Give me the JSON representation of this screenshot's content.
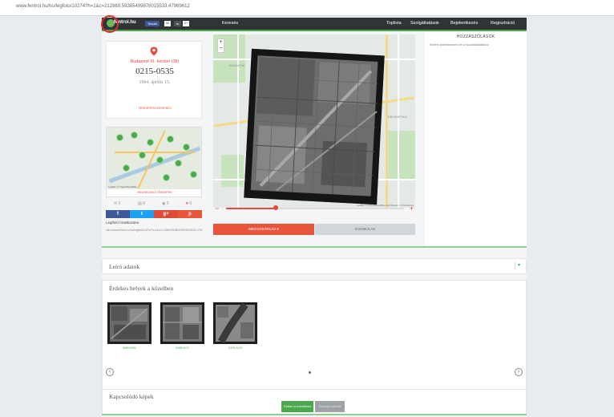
{
  "browser": {
    "url": "www.fentrol.hu/hu/fegfoto/10274?h=1&c=212869.59385499876015533.47969612"
  },
  "nav": {
    "logo": "fentrol.hu",
    "fb_like": "Tetszik",
    "fb_like_count": "32",
    "fb_share_label": "m",
    "fb_share_count": "2+",
    "search_link": "Keresés",
    "links": [
      "Toplista",
      "Szolgáltatások",
      "Bejelentkezés",
      "Regisztráció"
    ]
  },
  "photo_info": {
    "location": "Budapest XI. kerület (38)",
    "id": "0215-0535",
    "date": "1964. április 15.",
    "map_link": "TÉRKÉPEN KERESÉS"
  },
  "minimap": {
    "attribution": "Leaflet | © OpenStreetMap",
    "show_more": "MEGNÉZEM A TÉRKÉPEN"
  },
  "stats": [
    {
      "icon": "comment-icon",
      "glyph": "✉",
      "value": "0"
    },
    {
      "icon": "image-icon",
      "glyph": "▤",
      "value": "8"
    },
    {
      "icon": "view-icon",
      "glyph": "◉",
      "value": "5"
    },
    {
      "icon": "heart-icon",
      "glyph": "♥",
      "value": "0"
    }
  ],
  "share": [
    {
      "name": "facebook",
      "glyph": "f",
      "color": "#3b5998"
    },
    {
      "name": "twitter",
      "glyph": "t",
      "color": "#1da1f2"
    },
    {
      "name": "googleplus",
      "glyph": "g+",
      "color": "#dd4b39"
    },
    {
      "name": "pinterest",
      "glyph": "p",
      "color": "#e8553d"
    }
  ],
  "source": {
    "label": "Légifotó hivatkozása",
    "url": "http://www.fentrol.hu/hu/legifoto/10274?h=1&c=212869.59385499876015533.47969612"
  },
  "main_map": {
    "place_labels": [
      "BUDAFOK",
      "KELENFÖLD"
    ],
    "attribution": "Leaflet | © OpenStreetMap contributors | © Fentrol.hu"
  },
  "zoom_controls": {
    "in": "+",
    "out": "−"
  },
  "slider": {
    "minus": "−",
    "plus": "+",
    "value_fraction": 0.28
  },
  "buttons": {
    "download": "MEGVÁSÁRLÁS ▾",
    "zoom": "ZOOMOLÁS"
  },
  "comments": {
    "title": "HOZZÁSZÓLÁSOK",
    "text": "Kérem jelentkezzen be a hozzászóláshoz"
  },
  "sections": {
    "description": "Leíró adatok",
    "nearby": "Érdekes helyek a közelben",
    "related": "Kapcsolódó képek"
  },
  "nearby_items": [
    {
      "label": "0689-0961"
    },
    {
      "label": "0465-0171"
    },
    {
      "label": "0476-0123"
    }
  ],
  "related_tabs": {
    "newest": "Ebben a menetben",
    "similar": "Évszám szerint"
  },
  "colors": {
    "brand_green": "#4aa84d",
    "accent_red": "#e8483b",
    "nav_dark": "#303436"
  }
}
